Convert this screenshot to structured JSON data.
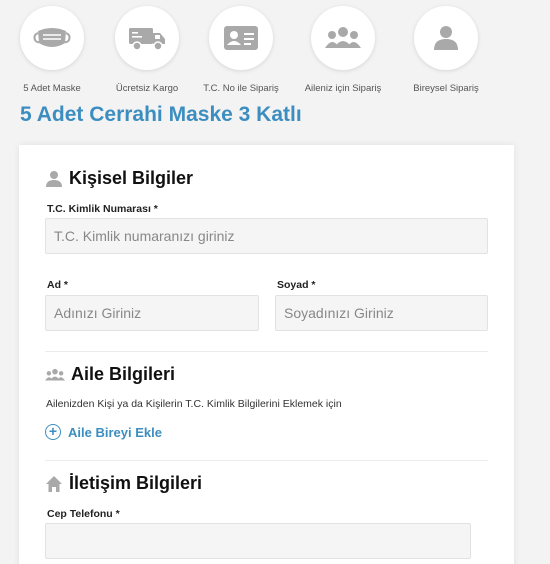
{
  "steps": [
    {
      "icon": "mask-icon",
      "label": "5 Adet Maske"
    },
    {
      "icon": "truck-icon",
      "label": "Ücretsiz Kargo"
    },
    {
      "icon": "id-card-icon",
      "label": "T.C. No ile Sipariş"
    },
    {
      "icon": "users-icon",
      "label": "Aileniz için Sipariş"
    },
    {
      "icon": "user-icon",
      "label": "Bireysel Sipariş"
    }
  ],
  "page_title": "5 Adet Cerrahi Maske 3 Katlı",
  "personal": {
    "title": "Kişisel Bilgiler",
    "tc_label": "T.C. Kimlik Numarası *",
    "tc_placeholder": "T.C. Kimlik numaranızı giriniz",
    "tc_value": "",
    "name_label": "Ad *",
    "name_placeholder": "Adınızı Giriniz",
    "name_value": "",
    "surname_label": "Soyad *",
    "surname_placeholder": "Soyadınızı Giriniz",
    "surname_value": ""
  },
  "family": {
    "title": "Aile Bilgileri",
    "description": "Ailenizden Kişi ya da Kişilerin T.C. Kimlik Bilgilerini Eklemek için",
    "add_label": "Aile Bireyi Ekle",
    "add_icon": "plus-circle-icon"
  },
  "contact": {
    "title": "İletişim Bilgileri",
    "phone_label": "Cep Telefonu *",
    "phone_value": ""
  },
  "colors": {
    "accent": "#3d8ec0",
    "icon_gray": "#a9a9a9",
    "background": "#f3f3f3"
  }
}
